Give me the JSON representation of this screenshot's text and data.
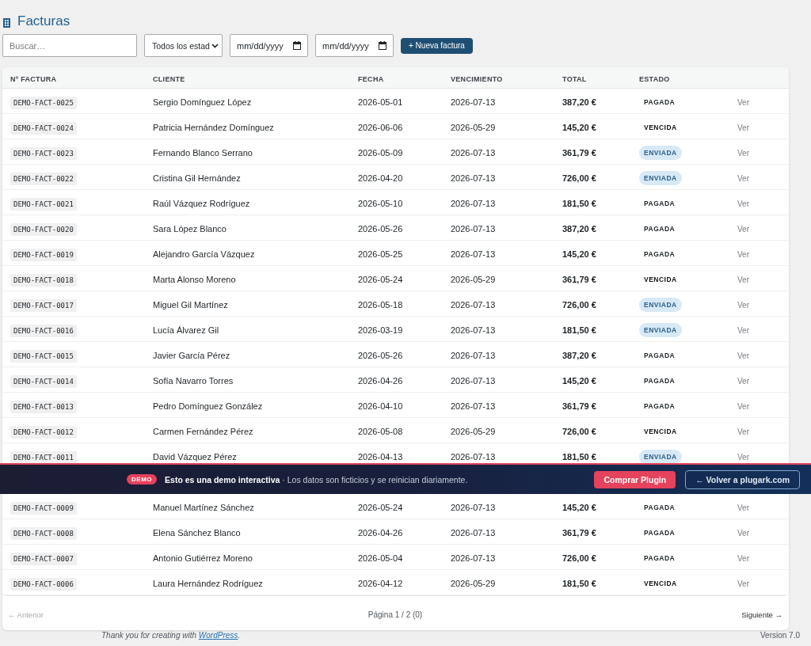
{
  "page": {
    "title": "Facturas"
  },
  "filters": {
    "search": {
      "placeholder": "Buscar…"
    },
    "status_select": {
      "value": "Todos los estad"
    },
    "date_from": {
      "placeholder": "mm/dd/yyyy"
    },
    "date_to": {
      "placeholder": "mm/dd/yyyy"
    },
    "new_button": "+ Nueva factura"
  },
  "table": {
    "columns": [
      "Nº FACTURA",
      "CLIENTE",
      "FECHA",
      "VENCIMIENTO",
      "TOTAL",
      "ESTADO"
    ],
    "rows": [
      {
        "number": "DEMO-FACT-0025",
        "client": "Sergio Domínguez López",
        "date": "2026-05-01",
        "due": "2026-07-13",
        "total": "387,20 €",
        "status": {
          "label": "PAGADA",
          "kind": "paid"
        },
        "action": "Ver"
      },
      {
        "number": "DEMO-FACT-0024",
        "client": "Patricia Hernández Domínguez",
        "date": "2026-06-06",
        "due": "2026-05-29",
        "total": "145,20 €",
        "status": {
          "label": "VENCIDA",
          "kind": "overdue"
        },
        "action": "Ver"
      },
      {
        "number": "DEMO-FACT-0023",
        "client": "Fernando Blanco Serrano",
        "date": "2026-05-09",
        "due": "2026-07-13",
        "total": "361,79 €",
        "status": {
          "label": "ENVIADA",
          "kind": "sent"
        },
        "action": "Ver"
      },
      {
        "number": "DEMO-FACT-0022",
        "client": "Cristina Gil Hernández",
        "date": "2026-04-20",
        "due": "2026-07-13",
        "total": "726,00 €",
        "status": {
          "label": "ENVIADA",
          "kind": "sent"
        },
        "action": "Ver"
      },
      {
        "number": "DEMO-FACT-0021",
        "client": "Raúl Vázquez Rodríguez",
        "date": "2026-05-10",
        "due": "2026-07-13",
        "total": "181,50 €",
        "status": {
          "label": "PAGADA",
          "kind": "paid"
        },
        "action": "Ver"
      },
      {
        "number": "DEMO-FACT-0020",
        "client": "Sara López Blanco",
        "date": "2026-05-26",
        "due": "2026-07-13",
        "total": "387,20 €",
        "status": {
          "label": "PAGADA",
          "kind": "paid"
        },
        "action": "Ver"
      },
      {
        "number": "DEMO-FACT-0019",
        "client": "Alejandro García Vázquez",
        "date": "2026-05-25",
        "due": "2026-07-13",
        "total": "145,20 €",
        "status": {
          "label": "PAGADA",
          "kind": "paid"
        },
        "action": "Ver"
      },
      {
        "number": "DEMO-FACT-0018",
        "client": "Marta Alonso Moreno",
        "date": "2026-05-24",
        "due": "2026-05-29",
        "total": "361,79 €",
        "status": {
          "label": "VENCIDA",
          "kind": "overdue"
        },
        "action": "Ver"
      },
      {
        "number": "DEMO-FACT-0017",
        "client": "Miguel Gil Martínez",
        "date": "2026-05-18",
        "due": "2026-07-13",
        "total": "726,00 €",
        "status": {
          "label": "ENVIADA",
          "kind": "sent"
        },
        "action": "Ver"
      },
      {
        "number": "DEMO-FACT-0016",
        "client": "Lucía Álvarez Gil",
        "date": "2026-03-19",
        "due": "2026-07-13",
        "total": "181,50 €",
        "status": {
          "label": "ENVIADA",
          "kind": "sent"
        },
        "action": "Ver"
      },
      {
        "number": "DEMO-FACT-0015",
        "client": "Javier García Pérez",
        "date": "2026-05-26",
        "due": "2026-07-13",
        "total": "387,20 €",
        "status": {
          "label": "PAGADA",
          "kind": "paid"
        },
        "action": "Ver"
      },
      {
        "number": "DEMO-FACT-0014",
        "client": "Sofía Navarro Torres",
        "date": "2026-04-26",
        "due": "2026-07-13",
        "total": "145,20 €",
        "status": {
          "label": "PAGADA",
          "kind": "paid"
        },
        "action": "Ver"
      },
      {
        "number": "DEMO-FACT-0013",
        "client": "Pedro Domínguez González",
        "date": "2026-04-10",
        "due": "2026-07-13",
        "total": "361,79 €",
        "status": {
          "label": "PAGADA",
          "kind": "paid"
        },
        "action": "Ver"
      },
      {
        "number": "DEMO-FACT-0012",
        "client": "Carmen Fernández Pérez",
        "date": "2026-05-08",
        "due": "2026-05-29",
        "total": "726,00 €",
        "status": {
          "label": "VENCIDA",
          "kind": "overdue"
        },
        "action": "Ver"
      },
      {
        "number": "DEMO-FACT-0011",
        "client": "David Vázquez Pérez",
        "date": "2026-04-13",
        "due": "2026-07-13",
        "total": "181,50 €",
        "status": {
          "label": "ENVIADA",
          "kind": "sent"
        },
        "action": "Ver"
      }
    ],
    "rows_below_banner": [
      {
        "number": "DEMO-FACT-0009",
        "client": "Manuel Martínez Sánchez",
        "date": "2026-05-24",
        "due": "2026-07-13",
        "total": "145,20 €",
        "status": {
          "label": "PAGADA",
          "kind": "paid"
        },
        "action": "Ver"
      },
      {
        "number": "DEMO-FACT-0008",
        "client": "Elena Sánchez Blanco",
        "date": "2026-04-26",
        "due": "2026-07-13",
        "total": "361,79 €",
        "status": {
          "label": "PAGADA",
          "kind": "paid"
        },
        "action": "Ver"
      },
      {
        "number": "DEMO-FACT-0007",
        "client": "Antonio Gutiérrez Moreno",
        "date": "2026-05-04",
        "due": "2026-07-13",
        "total": "726,00 €",
        "status": {
          "label": "PAGADA",
          "kind": "paid"
        },
        "action": "Ver"
      },
      {
        "number": "DEMO-FACT-0006",
        "client": "Laura Hernández Rodríguez",
        "date": "2026-04-12",
        "due": "2026-05-29",
        "total": "181,50 €",
        "status": {
          "label": "VENCIDA",
          "kind": "overdue"
        },
        "action": "Ver"
      }
    ]
  },
  "pagination": {
    "previous": {
      "label": "← Anterior",
      "disabled": true
    },
    "page_info": "Página 1 / 2 (0)",
    "next": {
      "label": "Siguiente →",
      "disabled": false
    }
  },
  "demo_banner": {
    "badge": "DEMO",
    "message": "**Esto es una demo interactiva** · Los datos son ficticios y se reinician diariamente.",
    "buy_button": "Comprar Plugin",
    "back_button": "← Volver a plugark.com"
  },
  "footer": {
    "credit_before": "Thank you for creating with",
    "credit_link": "WordPress",
    "credit_after": ".",
    "version": "Version 7.0"
  }
}
